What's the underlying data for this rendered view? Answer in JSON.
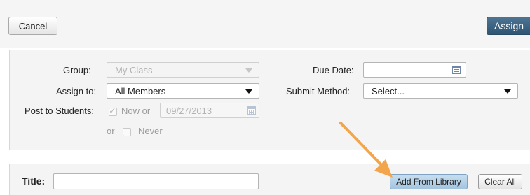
{
  "toolbar": {
    "cancel_label": "Cancel",
    "assign_label": "Assign"
  },
  "form": {
    "group": {
      "label": "Group:",
      "value": "My Class"
    },
    "assign_to": {
      "label": "Assign to:",
      "value": "All Members"
    },
    "post_to_students": {
      "label": "Post to Students:",
      "now_label": "Now or",
      "date_value": "09/27/2013",
      "or_label": "or",
      "never_label": "Never"
    },
    "due_date": {
      "label": "Due Date:",
      "value": ""
    },
    "submit_method": {
      "label": "Submit Method:",
      "value": "Select..."
    }
  },
  "title_section": {
    "label": "Title:",
    "value": "",
    "add_from_library_label": "Add From Library",
    "clear_all_label": "Clear All"
  },
  "colors": {
    "assign_button": "#3d6584",
    "library_button": "#b6d1e7",
    "annotation_arrow": "#f2a54b"
  },
  "icons": {
    "calendar": "calendar-icon",
    "dropdown": "chevron-down-icon",
    "checkmark": "checkmark-icon"
  }
}
